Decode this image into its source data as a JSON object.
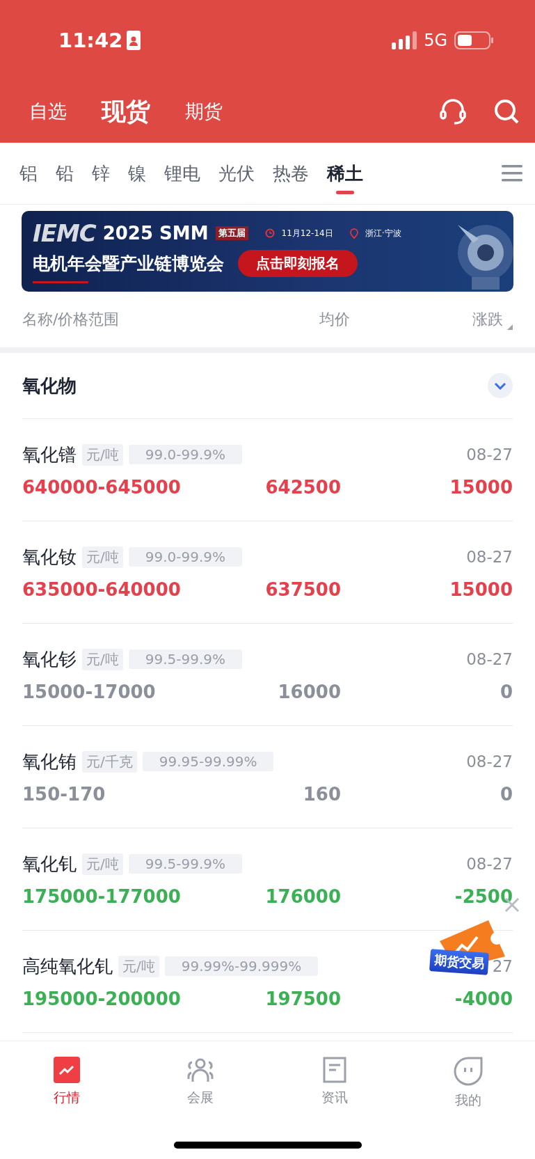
{
  "status_bar": {
    "time": "11:42",
    "network": "5G"
  },
  "header": {
    "tabs": [
      {
        "label": "自选",
        "selected": false
      },
      {
        "label": "现货",
        "selected": true
      },
      {
        "label": "期货",
        "selected": false
      }
    ]
  },
  "categories": [
    {
      "label": "铝",
      "selected": false
    },
    {
      "label": "铅",
      "selected": false
    },
    {
      "label": "锌",
      "selected": false
    },
    {
      "label": "镍",
      "selected": false
    },
    {
      "label": "锂电",
      "selected": false
    },
    {
      "label": "光伏",
      "selected": false
    },
    {
      "label": "热卷",
      "selected": false
    },
    {
      "label": "稀土",
      "selected": true
    }
  ],
  "banner": {
    "logo": "IEMC",
    "title": "2025 SMM",
    "edition": "第五届",
    "date": "11月12-14日",
    "location": "浙江·宁波",
    "subtitle": "电机年会暨产业链博览会",
    "button": "点击即刻报名"
  },
  "columns": [
    "名称/价格范围",
    "均价",
    "涨跌"
  ],
  "section": {
    "title": "氧化物",
    "expanded": true
  },
  "rows": [
    {
      "name": "氧化镨",
      "unit": "元/吨",
      "spec": "99.0-99.9%",
      "date": "08-27",
      "range": "640000-645000",
      "avg": "642500",
      "change": "15000",
      "color": "#e5414d"
    },
    {
      "name": "氧化钕",
      "unit": "元/吨",
      "spec": "99.0-99.9%",
      "date": "08-27",
      "range": "635000-640000",
      "avg": "637500",
      "change": "15000",
      "color": "#e5414d"
    },
    {
      "name": "氧化钐",
      "unit": "元/吨",
      "spec": "99.5-99.9%",
      "date": "08-27",
      "range": "15000-17000",
      "avg": "16000",
      "change": "0",
      "color": "#8a8f99"
    },
    {
      "name": "氧化铕",
      "unit": "元/千克",
      "spec": "99.95-99.99%",
      "date": "08-27",
      "range": "150-170",
      "avg": "160",
      "change": "0",
      "color": "#8a8f99"
    },
    {
      "name": "氧化钆",
      "unit": "元/吨",
      "spec": "99.5-99.9%",
      "date": "08-27",
      "range": "175000-177000",
      "avg": "176000",
      "change": "-2500",
      "color": "#3cb054"
    },
    {
      "name": "高纯氧化钆",
      "unit": "元/吨",
      "spec": "99.99%-99.999%",
      "date": "27",
      "range": "195000-200000",
      "avg": "197500",
      "change": "-4000",
      "color": "#3cb054"
    }
  ],
  "float_badge": {
    "label": "期货交易"
  },
  "bottom_nav": [
    {
      "label": "行情",
      "selected": true,
      "kind": "chart"
    },
    {
      "label": "会展",
      "selected": false,
      "kind": "people"
    },
    {
      "label": "资讯",
      "selected": false,
      "kind": "doc"
    },
    {
      "label": "我的",
      "selected": false,
      "kind": "face"
    }
  ]
}
